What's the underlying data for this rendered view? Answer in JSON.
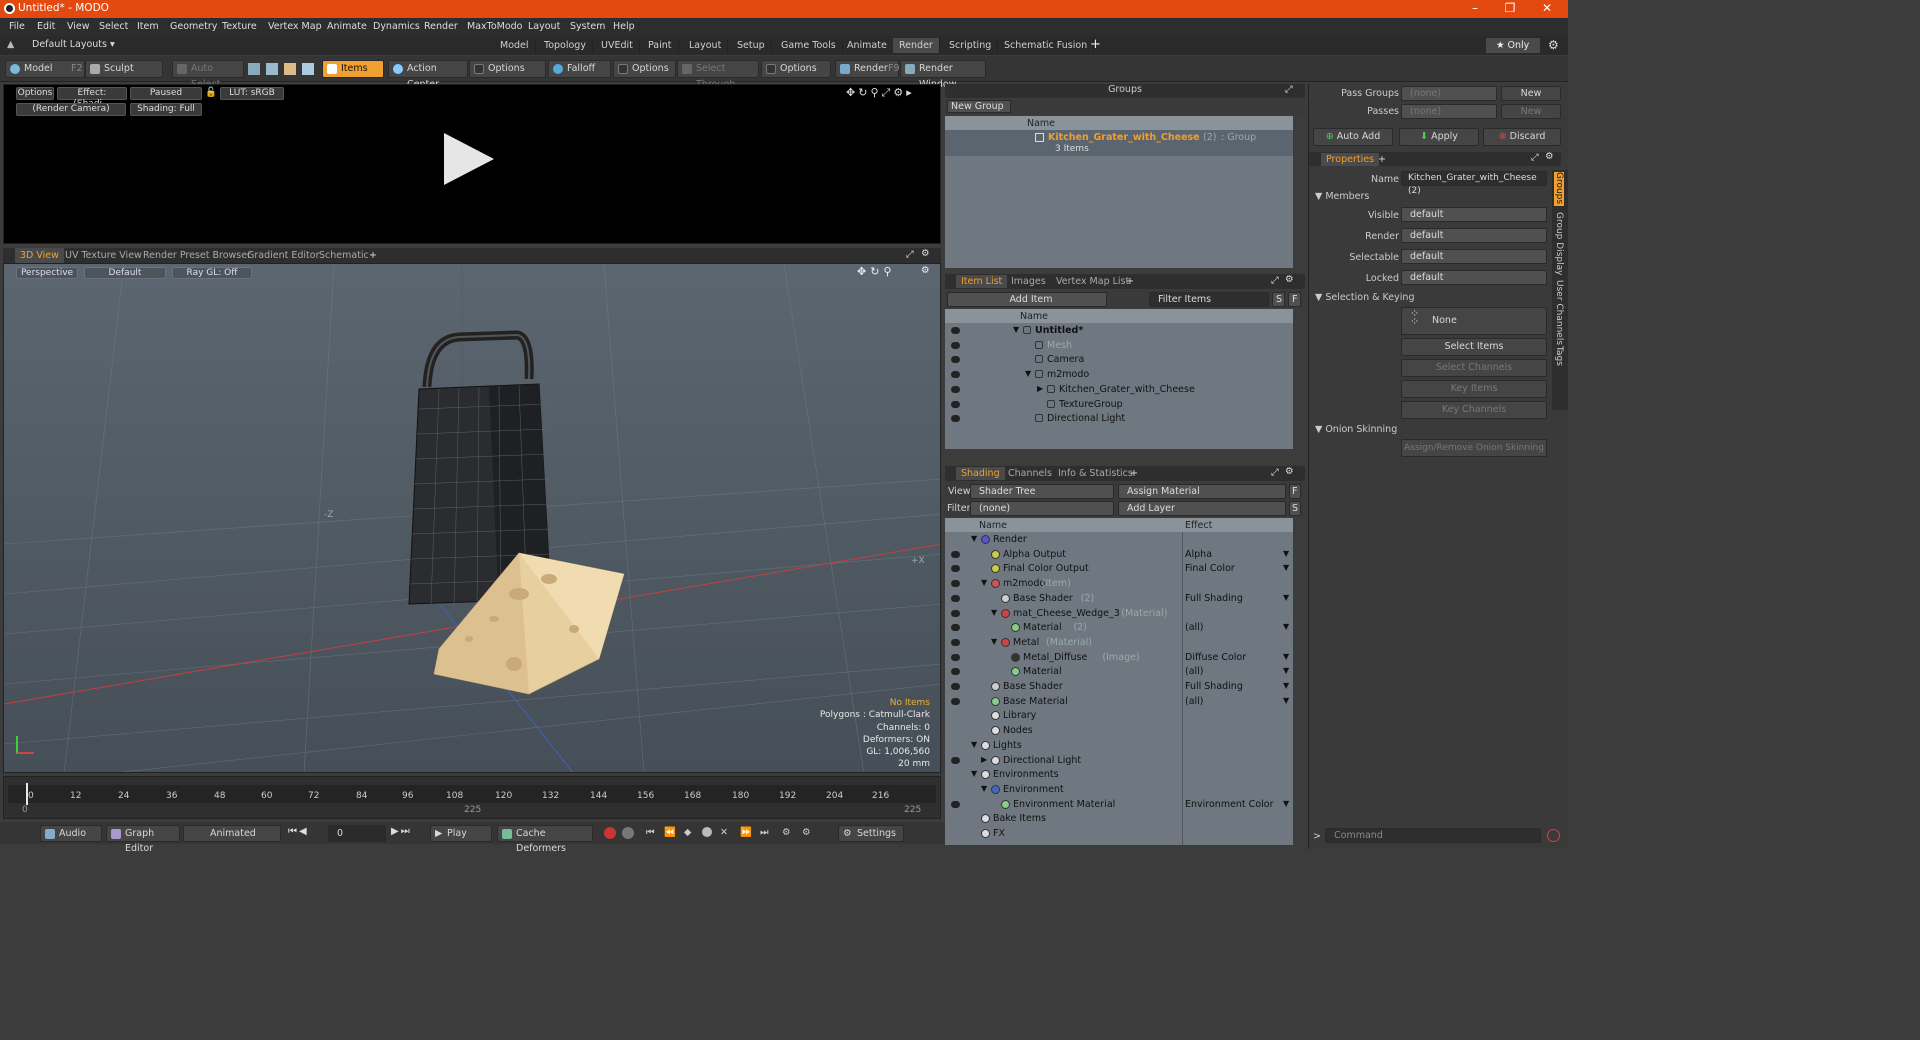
{
  "window": {
    "title": "Untitled* - MODO",
    "min": "–",
    "max": "❐",
    "close": "✕"
  },
  "menu": [
    "File",
    "Edit",
    "View",
    "Select",
    "Item",
    "Geometry",
    "Texture",
    "Vertex Map",
    "Animate",
    "Dynamics",
    "Render",
    "MaxToModo",
    "Layout",
    "System",
    "Help"
  ],
  "layoutbar": {
    "layouts": "Default Layouts ▾",
    "tabs": [
      "Model",
      "Topology",
      "UVEdit",
      "Paint",
      "Layout",
      "Setup",
      "Game Tools",
      "Animate",
      "Render",
      "Scripting",
      "Schematic Fusion"
    ],
    "active": "Render",
    "plus": "+",
    "only": "★ Only"
  },
  "toolbar": {
    "model": "Model",
    "model_key": "F2",
    "sculpt": "Sculpt",
    "auto_select": "Auto Select",
    "items": "Items",
    "action_center": "Action Center",
    "options1": "Options",
    "falloff": "Falloff",
    "options2": "Options",
    "select_through": "Select Through",
    "options3": "Options",
    "render": "Render",
    "render_key": "F9",
    "render_window": "Render Window"
  },
  "preview": {
    "options": "Options",
    "effect": "Effect: (Shadi...",
    "paused": "Paused",
    "lut": "LUT: sRGB",
    "camera": "(Render Camera)",
    "shading": "Shading: Full"
  },
  "viewtabs": [
    "3D View",
    "UV Texture View",
    "Render Preset Browser",
    "Gradient Editor",
    "Schematic",
    "+"
  ],
  "viewport": {
    "perspective": "Perspective",
    "default": "Default",
    "raygl": "Ray GL: Off",
    "axis_z": "-Z",
    "axis_x": "+X",
    "stats": [
      "No Items",
      "Polygons : Catmull-Clark",
      "Channels: 0",
      "Deformers: ON",
      "GL: 1,006,560",
      "20 mm"
    ]
  },
  "timeline": {
    "ticks": [
      "0",
      "12",
      "24",
      "36",
      "48",
      "60",
      "72",
      "84",
      "96",
      "108",
      "120",
      "132",
      "144",
      "156",
      "168",
      "180",
      "192",
      "204",
      "216"
    ],
    "end_labels": [
      "0",
      "225",
      "225"
    ]
  },
  "bottombar": {
    "audio": "Audio",
    "graph_editor": "Graph Editor",
    "animated": "Animated",
    "frame": "0",
    "play": "Play",
    "cache": "Cache Deformers",
    "settings": "Settings"
  },
  "groups": {
    "title": "Groups",
    "new_group": "New Group",
    "col_name": "Name",
    "group_name": "Kitchen_Grater_with_Cheese",
    "group_count": "(2)",
    "group_type": ": Group",
    "group_items": "3 Items"
  },
  "itemlist": {
    "tabs": [
      "Item List",
      "Images",
      "Vertex Map List",
      "+"
    ],
    "add_item": "Add Item",
    "filter": "Filter Items",
    "s": "S",
    "f": "F",
    "col_name": "Name",
    "items": [
      {
        "label": "Untitled*",
        "indent": 0,
        "bold": true,
        "arrow": "▼"
      },
      {
        "label": "Mesh",
        "indent": 1,
        "dim": true,
        "arrow": ""
      },
      {
        "label": "Camera",
        "indent": 1,
        "arrow": ""
      },
      {
        "label": "m2modo",
        "indent": 1,
        "arrow": "▼"
      },
      {
        "label": "Kitchen_Grater_with_Cheese",
        "indent": 2,
        "arrow": "▶"
      },
      {
        "label": "TextureGroup",
        "indent": 2,
        "arrow": ""
      },
      {
        "label": "Directional Light",
        "indent": 1,
        "arrow": ""
      }
    ]
  },
  "shading": {
    "tabs": [
      "Shading",
      "Channels",
      "Info & Statistics",
      "+"
    ],
    "view_label": "View",
    "view_value": "Shader Tree",
    "assign_material": "Assign Material",
    "f": "F",
    "filter_label": "Filter",
    "filter_value": "(none)",
    "add_layer": "Add Layer",
    "s": "S",
    "col_name": "Name",
    "col_effect": "Effect",
    "rows": [
      {
        "label": "Render",
        "indent": 0,
        "arrow": "▼",
        "effect": "",
        "eye": false
      },
      {
        "label": "Alpha Output",
        "indent": 1,
        "effect": "Alpha",
        "eye": true
      },
      {
        "label": "Final Color Output",
        "indent": 1,
        "effect": "Final Color",
        "eye": true
      },
      {
        "label": "m2modo",
        "tag": "(Item)",
        "indent": 1,
        "arrow": "▼",
        "effect": "",
        "eye": true
      },
      {
        "label": "Base Shader",
        "tag": "(2)",
        "indent": 2,
        "effect": "Full Shading",
        "eye": true
      },
      {
        "label": "mat_Cheese_Wedge_3",
        "tag": "(Material)",
        "indent": 2,
        "arrow": "▼",
        "effect": "",
        "eye": true
      },
      {
        "label": "Material",
        "tag": "(2)",
        "indent": 3,
        "effect": "(all)",
        "eye": true
      },
      {
        "label": "Metal",
        "tag": "(Material)",
        "indent": 2,
        "arrow": "▼",
        "effect": "",
        "eye": true
      },
      {
        "label": "Metal_Diffuse",
        "tag": "(Image)",
        "indent": 3,
        "effect": "Diffuse Color",
        "eye": true
      },
      {
        "label": "Material",
        "indent": 3,
        "effect": "(all)",
        "eye": true
      },
      {
        "label": "Base Shader",
        "indent": 1,
        "effect": "Full Shading",
        "eye": true
      },
      {
        "label": "Base Material",
        "indent": 1,
        "effect": "(all)",
        "eye": true
      },
      {
        "label": "Library",
        "indent": 1,
        "effect": "",
        "eye": false
      },
      {
        "label": "Nodes",
        "indent": 1,
        "effect": "",
        "eye": false
      },
      {
        "label": "Lights",
        "indent": 0,
        "arrow": "▼",
        "effect": "",
        "eye": false
      },
      {
        "label": "Directional Light",
        "indent": 1,
        "arrow": "▶",
        "effect": "",
        "eye": true
      },
      {
        "label": "Environments",
        "indent": 0,
        "arrow": "▼",
        "effect": "",
        "eye": false
      },
      {
        "label": "Environment",
        "indent": 1,
        "arrow": "▼",
        "effect": "",
        "eye": false
      },
      {
        "label": "Environment Material",
        "indent": 2,
        "effect": "Environment Color",
        "eye": true
      },
      {
        "label": "Bake Items",
        "indent": 0,
        "effect": "",
        "eye": false
      },
      {
        "label": "FX",
        "indent": 0,
        "effect": "",
        "eye": false
      }
    ]
  },
  "props": {
    "pass_groups": "Pass Groups",
    "passes": "Passes",
    "none": "(none)",
    "new": "New",
    "auto_add": "Auto Add",
    "apply": "Apply",
    "discard": "Discard",
    "tab": "Properties",
    "plus": "+",
    "name_label": "Name",
    "name_value": "Kitchen_Grater_with_Cheese (2)",
    "members": "Members",
    "visible": "Visible",
    "render": "Render",
    "selectable": "Selectable",
    "locked": "Locked",
    "default": "default",
    "sel_keying": "Selection & Keying",
    "none_btn": "None",
    "select_items": "Select Items",
    "select_channels": "Select Channels",
    "key_items": "Key Items",
    "key_channels": "Key Channels",
    "onion": "Onion Skinning",
    "assign_onion": "Assign/Remove Onion Skinning",
    "side_tabs": [
      "Groups",
      "Group Display",
      "User Channels",
      "Tags"
    ],
    "command": "Command"
  }
}
